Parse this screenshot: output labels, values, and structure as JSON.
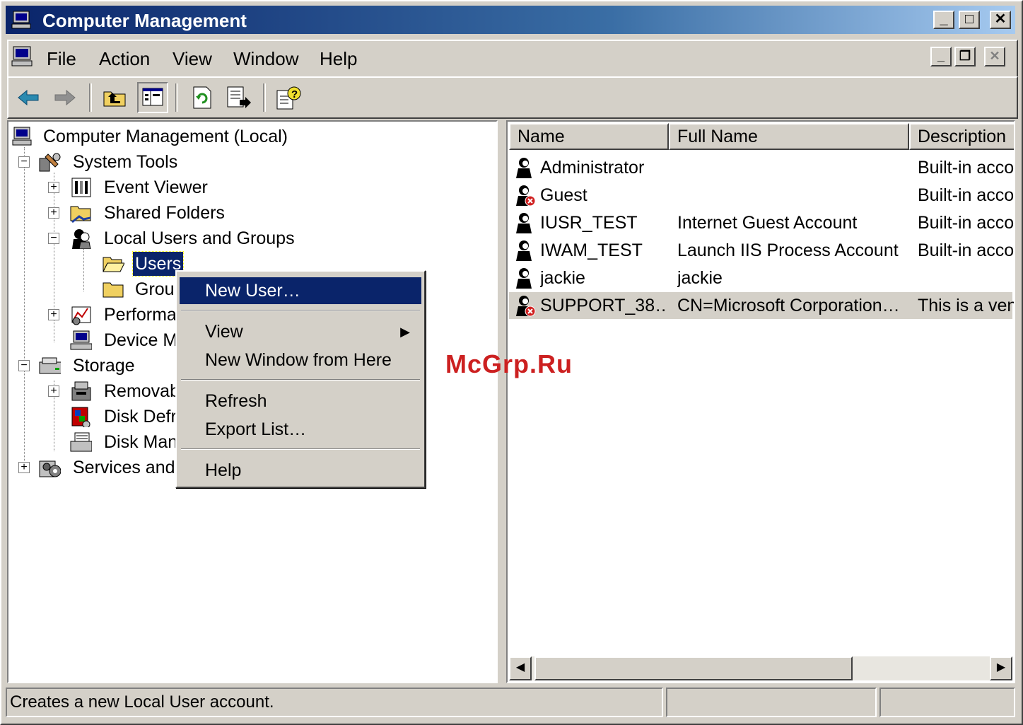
{
  "window": {
    "title": "Computer Management"
  },
  "title_buttons": {
    "minimize": "_",
    "maximize": "□",
    "close": "✕"
  },
  "menu": {
    "items": [
      {
        "label": "File"
      },
      {
        "label": "Action"
      },
      {
        "label": "View"
      },
      {
        "label": "Window"
      },
      {
        "label": "Help"
      }
    ]
  },
  "mdi_buttons": {
    "minimize": "_",
    "restore": "❐",
    "close": "✕"
  },
  "toolbar": {
    "icons": [
      "back-icon",
      "forward-icon",
      "up-level-icon",
      "show-hide-tree-icon",
      "refresh-icon",
      "export-list-icon",
      "help-icon"
    ]
  },
  "tree": {
    "root": "Computer Management (Local)",
    "system_tools": "System Tools",
    "event_viewer": "Event Viewer",
    "shared_folders": "Shared Folders",
    "local_users_groups": "Local Users and Groups",
    "users": "Users",
    "groups": "Group",
    "performance": "Performa",
    "device_manager": "Device M",
    "storage": "Storage",
    "removable": "Removab",
    "disk_defrag": "Disk Defr",
    "disk_mgmt": "Disk Mana",
    "services": "Services and"
  },
  "list": {
    "columns": [
      "Name",
      "Full Name",
      "Description"
    ],
    "rows": [
      {
        "name": "Administrator",
        "full_name": "",
        "description": "Built-in accou",
        "disabled": false
      },
      {
        "name": "Guest",
        "full_name": "",
        "description": "Built-in accou",
        "disabled": true
      },
      {
        "name": "IUSR_TEST",
        "full_name": "Internet Guest Account",
        "description": "Built-in accou",
        "disabled": false
      },
      {
        "name": "IWAM_TEST",
        "full_name": "Launch IIS Process Account",
        "description": "Built-in accou",
        "disabled": false
      },
      {
        "name": "jackie",
        "full_name": "jackie",
        "description": "",
        "disabled": false
      },
      {
        "name": "SUPPORT_38…",
        "full_name": "CN=Microsoft Corporation…",
        "description": "This is a ven",
        "disabled": true
      }
    ]
  },
  "context_menu": {
    "new_user": "New User…",
    "view": "View",
    "new_window": "New Window from Here",
    "refresh": "Refresh",
    "export_list": "Export List…",
    "help": "Help"
  },
  "status_bar": {
    "text": "Creates a new Local User account."
  },
  "watermark": "McGrp.Ru",
  "colors": {
    "titlebar_start": "#0a246a",
    "titlebar_end": "#a6caf0",
    "face": "#d4d0c8",
    "selection": "#0a246a"
  }
}
